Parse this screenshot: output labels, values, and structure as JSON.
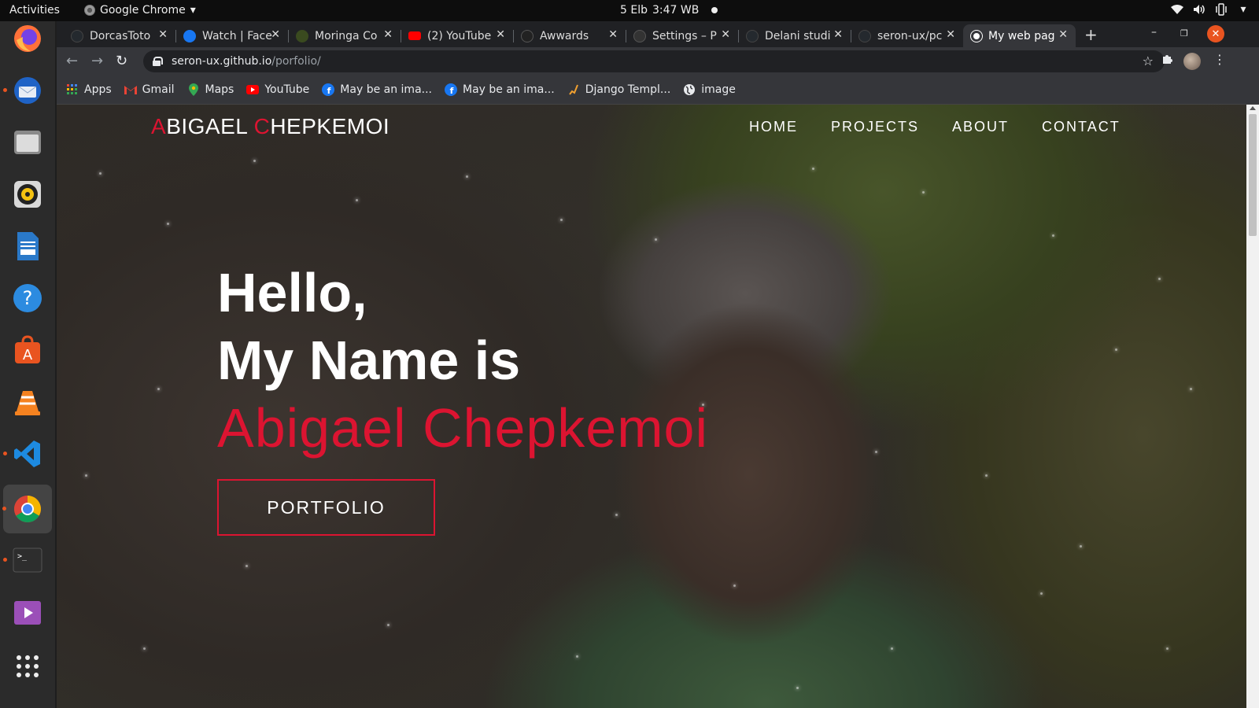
{
  "topbar": {
    "activities": "Activities",
    "app_name": "Google Chrome",
    "clock_date": "5 Elb",
    "clock_time": "3:47 WB"
  },
  "dock": {
    "apps": [
      "firefox",
      "thunderbird",
      "files",
      "rhythmbox",
      "libreoffice-writer",
      "help",
      "software-center",
      "vlc",
      "vscode",
      "chrome",
      "terminal",
      "videos",
      "show-applications"
    ]
  },
  "tabs": [
    {
      "title": "DorcasToto",
      "icon": "github-icon",
      "color": "#24292e"
    },
    {
      "title": "Watch | Face",
      "icon": "facebook-icon",
      "color": "#1877f2"
    },
    {
      "title": "Moringa Co",
      "icon": "moringa-icon",
      "color": "#3a4a1f"
    },
    {
      "title": "(2) YouTube",
      "icon": "youtube-icon",
      "color": "#ff0000"
    },
    {
      "title": "Awwards",
      "icon": "awwards-icon",
      "color": "#222"
    },
    {
      "title": "Settings – P",
      "icon": "settings-icon",
      "color": "#333"
    },
    {
      "title": "Delani studi",
      "icon": "github-icon",
      "color": "#24292e"
    },
    {
      "title": "seron-ux/pc",
      "icon": "github-icon",
      "color": "#24292e"
    },
    {
      "title": "My web pag",
      "icon": "globe-icon",
      "color": "#ffffff",
      "active": true
    }
  ],
  "omnibox": {
    "host": "seron-ux.github.io",
    "path": "/porfolio/"
  },
  "bookmarks": [
    {
      "label": "Apps",
      "icon": "apps-grid-icon"
    },
    {
      "label": "Gmail",
      "icon": "gmail-icon"
    },
    {
      "label": "Maps",
      "icon": "maps-icon"
    },
    {
      "label": "YouTube",
      "icon": "youtube-icon"
    },
    {
      "label": "May be an ima...",
      "icon": "facebook-icon"
    },
    {
      "label": "May be an ima...",
      "icon": "facebook-icon"
    },
    {
      "label": "Django Templ...",
      "icon": "django-icon"
    },
    {
      "label": "image",
      "icon": "globe-icon"
    }
  ],
  "site": {
    "brand_first_initial": "A",
    "brand_first_rest": "BIGAEL ",
    "brand_last_initial": "C",
    "brand_last_rest": "HEPKEMOI",
    "nav": [
      "HOME",
      "PROJECTS",
      "ABOUT",
      "CONTACT"
    ],
    "hero_line1": "Hello,",
    "hero_line2": "My Name is",
    "hero_name": "Abigael Chepkemoi",
    "cta_label": "PORTFOLIO"
  },
  "colors": {
    "accent": "#dc1431",
    "ubuntu_orange": "#e95420"
  }
}
